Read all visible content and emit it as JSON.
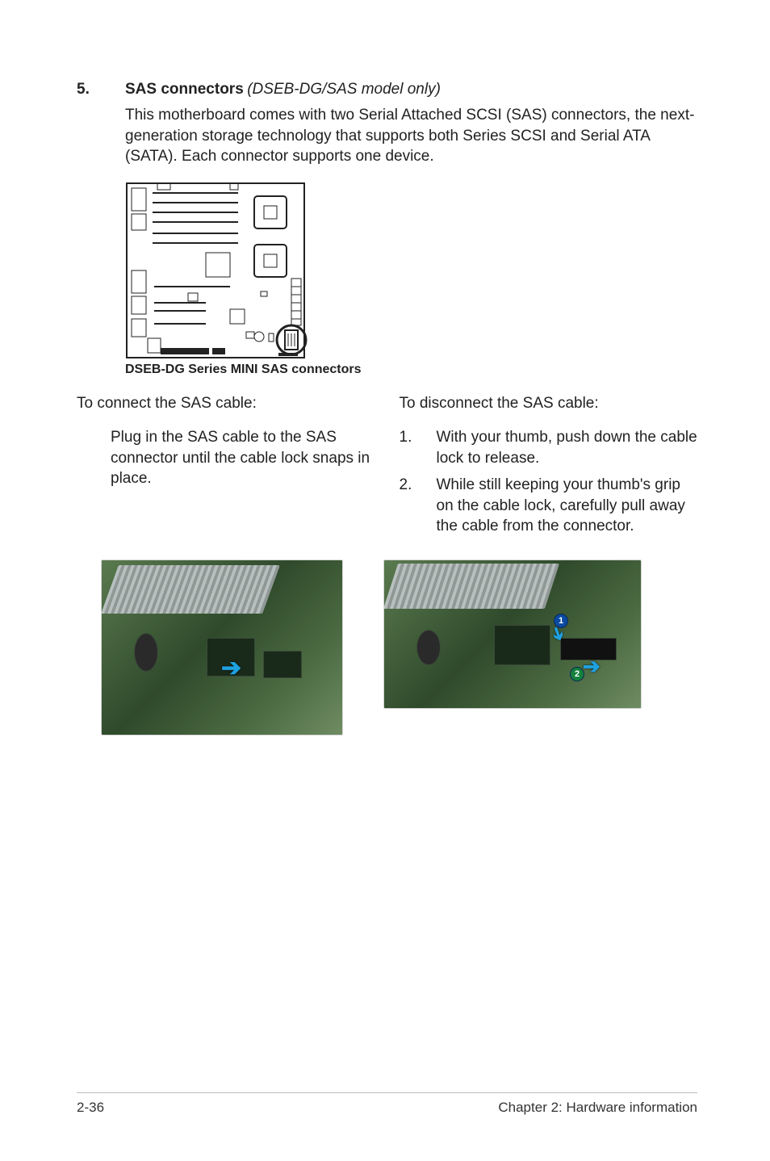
{
  "section": {
    "number": "5.",
    "title": "SAS connectors",
    "note": "(DSEB-DG/SAS model only)"
  },
  "body_para": "This motherboard comes with two Serial Attached SCSI (SAS) connectors, the next-generation storage technology that supports both Series SCSI and Serial ATA (SATA). Each connector supports one device.",
  "diagram_caption": "DSEB-DG Series MINI SAS connectors",
  "left_col": {
    "heading": "To connect the SAS cable:",
    "body": "Plug in the SAS cable to the SAS connector until the cable lock snaps in place."
  },
  "right_col": {
    "heading": "To disconnect the SAS cable:",
    "steps": [
      {
        "n": "1.",
        "t": "With your thumb, push down the cable lock to release."
      },
      {
        "n": "2.",
        "t": "While still keeping your thumb's grip on the cable lock, carefully pull away the cable from the connector."
      }
    ]
  },
  "callouts": {
    "one": "1",
    "two": "2"
  },
  "footer": {
    "left": "2-36",
    "right": "Chapter 2: Hardware information"
  }
}
